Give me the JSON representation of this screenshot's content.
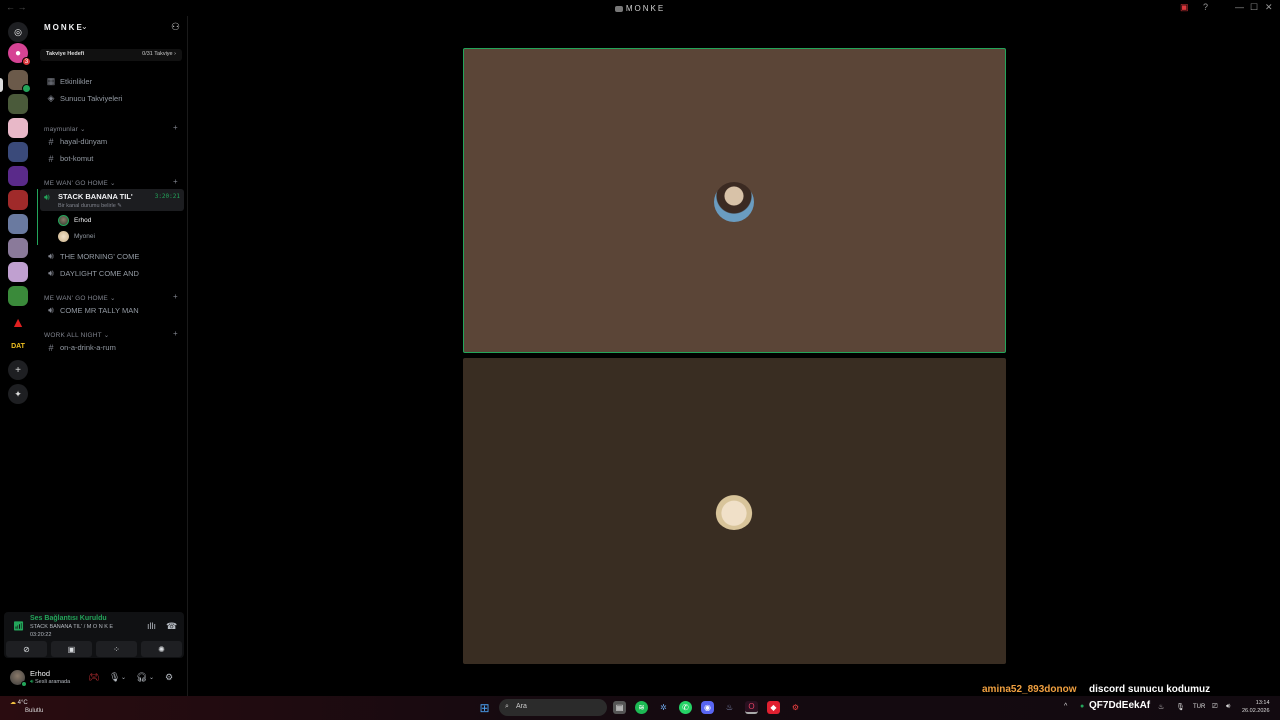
{
  "window": {
    "title": "MONKE",
    "nav_glyph": "← →",
    "controls": {
      "minimize": "—",
      "maximize": "☐",
      "close": "✕"
    }
  },
  "server": {
    "name": "MONKE",
    "boost_goal_label": "Takviye Hedefi",
    "boost_goal_value": "0/31 Takviye"
  },
  "menu": {
    "events": "Etkinlikler",
    "server_boosts": "Sunucu Takviyeleri"
  },
  "categories": [
    {
      "label": "maymunlar",
      "channels": [
        "hayal-dünyam",
        "bot-komut"
      ]
    },
    {
      "label": "ME WAN' GO HOME"
    },
    {
      "label": "ME WAN' GO HOME"
    },
    {
      "label": "WORK ALL NIGHT",
      "channels": [
        "on-a-drink-a-rum"
      ]
    }
  ],
  "active_voice": {
    "name": "STACK BANANA TIL'",
    "status": "Bir kanal durumu belirle",
    "timer": "3:20:21",
    "users": [
      "Erhod",
      "Myonei"
    ]
  },
  "voice_channels": [
    "THE MORNING' COME",
    "DAYLIGHT COME AND",
    "COME MR TALLY MAN"
  ],
  "voice_panel": {
    "status": "Ses Bağlantısı Kuruldu",
    "channel": "STACK BANANA TIL' / M O N K E",
    "time": "03:20:22"
  },
  "user": {
    "name": "Erhod",
    "status": "Sesli aramada"
  },
  "overlay": {
    "user": "amina52_893donow",
    "message": "discord sunucu kodumuz",
    "code": "QF7DdEekAf"
  },
  "taskbar": {
    "weather_temp": "4°C",
    "weather_desc": "Bulutlu",
    "search_placeholder": "Ara",
    "lang": "TUR",
    "time": "13:14",
    "date": "26.02.2026"
  },
  "colors": {
    "accent_green": "#23a55a",
    "tile1": "#5b4537",
    "tile2": "#392d22",
    "overlay_user": "#f0a040"
  }
}
